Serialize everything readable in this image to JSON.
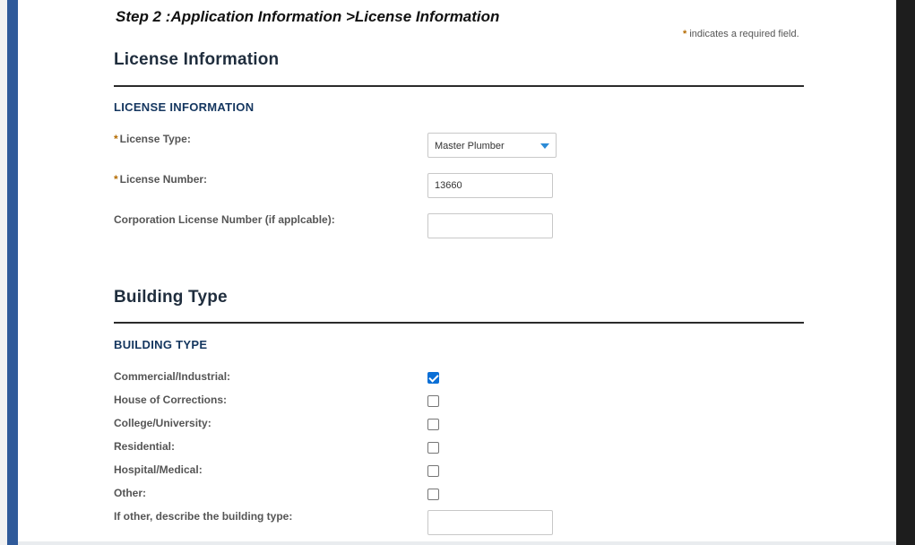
{
  "breadcrumb": {
    "step": "Step 2",
    "sep1": ":",
    "section": "Application Information",
    "sep2": ">",
    "page": "License Information"
  },
  "required_note": {
    "star": "*",
    "text": "indicates a required field."
  },
  "license_section": {
    "title": "License Information",
    "subtitle": "LICENSE INFORMATION",
    "license_type": {
      "required_star": "*",
      "label": "License Type:",
      "value": "Master Plumber",
      "icon": "chevron-down-icon"
    },
    "license_number": {
      "required_star": "*",
      "label": "License Number:",
      "value": "13660"
    },
    "corporation_license_number": {
      "label": "Corporation License Number (if applcable):",
      "value": ""
    }
  },
  "building_section": {
    "title": "Building Type",
    "subtitle": "BUILDING TYPE",
    "options": [
      {
        "label": "Commercial/Industrial:",
        "checked": true
      },
      {
        "label": "House of Corrections:",
        "checked": false
      },
      {
        "label": "College/University:",
        "checked": false
      },
      {
        "label": "Residential:",
        "checked": false
      },
      {
        "label": "Hospital/Medical:",
        "checked": false
      },
      {
        "label": "Other:",
        "checked": false
      }
    ],
    "other_description": {
      "label": "If other, describe the building type:",
      "value": ""
    }
  },
  "colors": {
    "accent_bar": "#2f5a9a",
    "checkbox_checked": "#0b6fd6",
    "required_star": "#b46b00"
  }
}
